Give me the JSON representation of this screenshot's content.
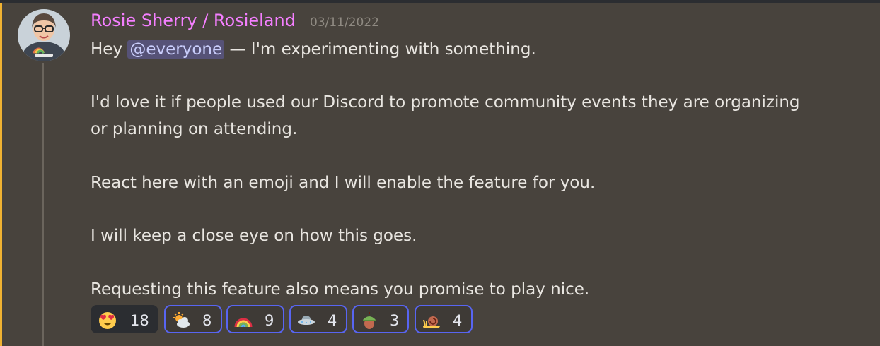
{
  "message": {
    "author": "Rosie Sherry / Rosieland",
    "timestamp": "03/11/2022",
    "greeting_prefix": "Hey",
    "mention": "@everyone",
    "greeting_suffix": "— I'm experimenting with something.",
    "para2_line1": "I'd love it if people used our Discord to promote community events they are organizing",
    "para2_line2": "or planning on attending.",
    "para3": "React here with an emoji and I will enable the feature for you.",
    "para4": "I will keep a close eye on how this goes.",
    "para5": "Requesting this feature also means you promise to play nice."
  },
  "reactions": [
    {
      "emoji": "heart-eyes-emoji",
      "count": "18",
      "selected": false
    },
    {
      "emoji": "sun-behind-cloud-emoji",
      "count": "8",
      "selected": true
    },
    {
      "emoji": "rainbow-emoji",
      "count": "9",
      "selected": true
    },
    {
      "emoji": "flying-saucer-emoji",
      "count": "4",
      "selected": true
    },
    {
      "emoji": "acorn-emoji",
      "count": "3",
      "selected": true
    },
    {
      "emoji": "snail-emoji",
      "count": "4",
      "selected": true
    }
  ],
  "colors": {
    "username": "#f47fff",
    "highlight_border": "#f0b232",
    "message_bg": "#48433d",
    "reaction_selected_border": "#5865f2",
    "mention_bg": "#565277"
  }
}
